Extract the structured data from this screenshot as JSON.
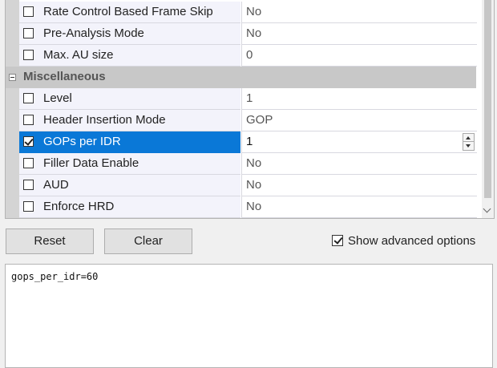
{
  "grid": {
    "rows_top": [
      {
        "label": "Rate Control Based Frame Skip",
        "value": "No",
        "checked": false
      },
      {
        "label": "Pre-Analysis Mode",
        "value": "No",
        "checked": false
      },
      {
        "label": "Max. AU size",
        "value": "0",
        "checked": false
      }
    ],
    "category": "Miscellaneous",
    "rows_misc": [
      {
        "label": "Level",
        "value": "1",
        "checked": false
      },
      {
        "label": "Header Insertion Mode",
        "value": "GOP",
        "checked": false
      },
      {
        "label": "GOPs per IDR",
        "value": "1",
        "checked": true,
        "selected": true
      },
      {
        "label": "Filler Data Enable",
        "value": "No",
        "checked": false
      },
      {
        "label": "AUD",
        "value": "No",
        "checked": false
      },
      {
        "label": "Enforce HRD",
        "value": "No",
        "checked": false
      }
    ]
  },
  "buttons": {
    "reset": "Reset",
    "clear": "Clear"
  },
  "advanced": {
    "label": "Show advanced options",
    "checked": true
  },
  "output": {
    "text": "gops_per_idr=60"
  },
  "colors": {
    "selection": "#0a78d7",
    "category_bg": "#c8c8c8"
  }
}
